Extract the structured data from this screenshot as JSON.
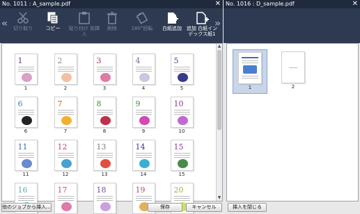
{
  "left_window": {
    "title": "No. 1011 : A_sample.pdf"
  },
  "right_window": {
    "title": "No. 1016 : D_sample.pdf"
  },
  "toolbar": {
    "cut": "切り取り",
    "copy": "コピー",
    "paste": "貼り付け",
    "insert": "前挿入",
    "delete": "削除",
    "rotate": "180°回転",
    "add_blank": "白紙追加",
    "add_index_line1": "追加 白紙イン",
    "add_index_line2": "デックス紙1"
  },
  "left_pages": [
    "1",
    "2",
    "3",
    "4",
    "5",
    "6",
    "7",
    "8",
    "9",
    "10",
    "11",
    "12",
    "13",
    "14",
    "15",
    "16",
    "17",
    "18",
    "19",
    "20"
  ],
  "right_pages": [
    "1",
    "2"
  ],
  "buttons": {
    "insert_from_job": "他のジョブから挿入...",
    "save": "保存",
    "cancel": "キャンセル",
    "close_insert": "挿入を閉じる"
  },
  "colors": {
    "titlebar": "#1f2a3d",
    "toolbar": "#2d3a52"
  }
}
